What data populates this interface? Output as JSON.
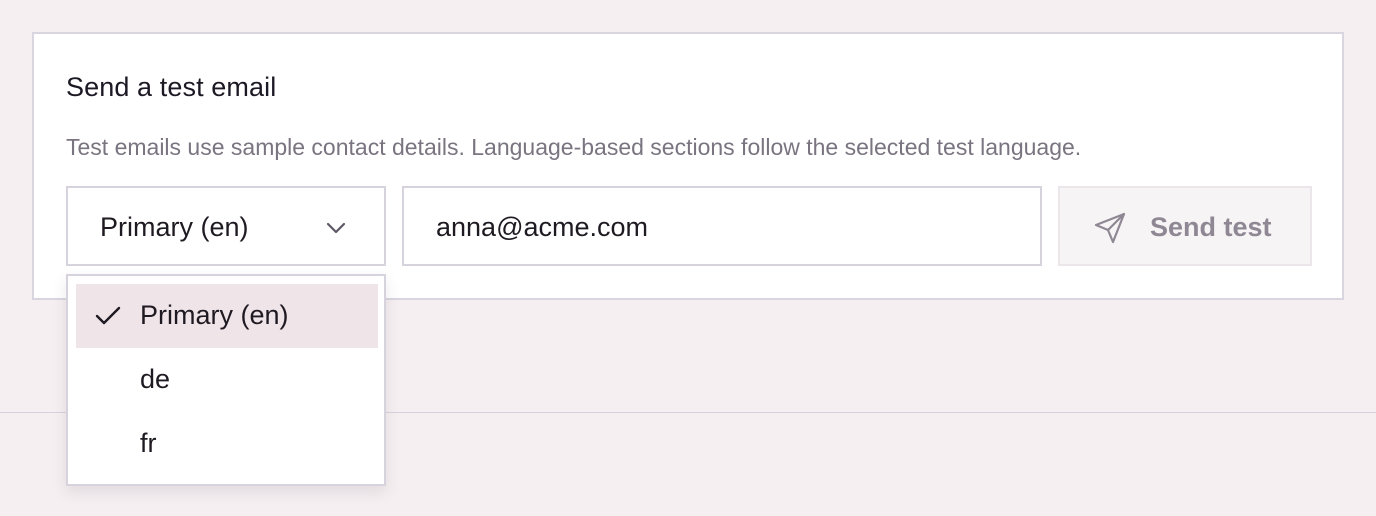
{
  "card": {
    "title": "Send a test email",
    "description": "Test emails use sample contact details. Language-based sections follow the selected test language."
  },
  "language_select": {
    "selected": "Primary (en)",
    "icon": "chevron-down-icon"
  },
  "email_input": {
    "value": "anna@acme.com"
  },
  "send_button": {
    "label": "Send test",
    "icon": "send-icon",
    "state": "disabled"
  },
  "dropdown": {
    "options": [
      {
        "label": "Primary (en)",
        "selected": true
      },
      {
        "label": "de",
        "selected": false
      },
      {
        "label": "fr",
        "selected": false
      }
    ]
  },
  "colors": {
    "background": "#f5eff1",
    "selected_option": "#efe4e8",
    "border": "#d7d3dc",
    "muted_text": "#7a7480"
  }
}
